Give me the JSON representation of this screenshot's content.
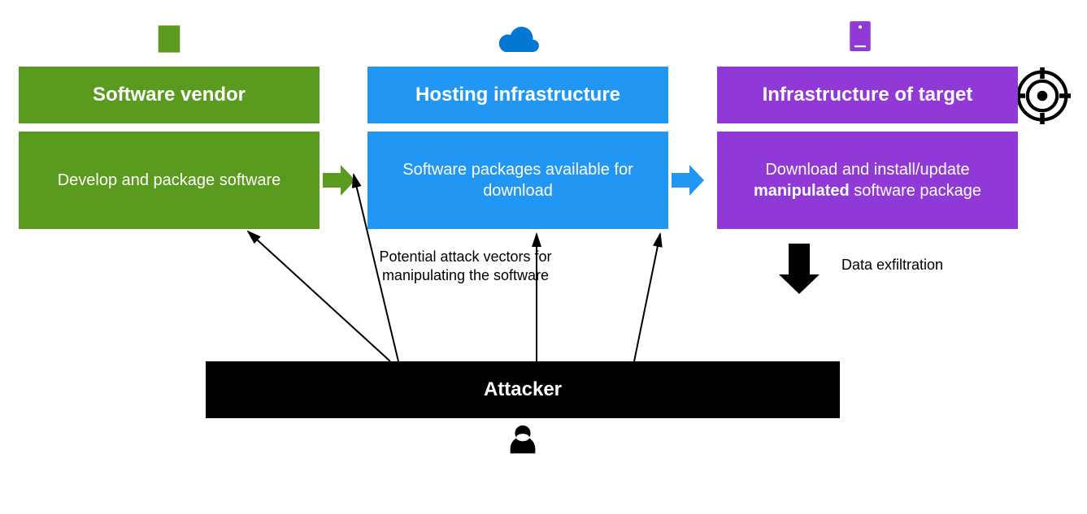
{
  "vendor": {
    "title": "Software vendor",
    "body": "Develop and package software"
  },
  "hosting": {
    "title": "Hosting infrastructure",
    "body": "Software packages available for download"
  },
  "target": {
    "title": "Infrastructure of target",
    "body_pre": "Download and install/update ",
    "body_bold": "manipulated",
    "body_post": " software package"
  },
  "attacker": {
    "title": "Attacker"
  },
  "labels": {
    "attack_vectors": "Potential attack vectors for manipulating the software",
    "exfiltration": "Data exfiltration"
  },
  "colors": {
    "green": "#5a9a1f",
    "blue": "#2196f3",
    "purple": "#9139d6",
    "black": "#000000",
    "cloud": "#0078d4"
  }
}
